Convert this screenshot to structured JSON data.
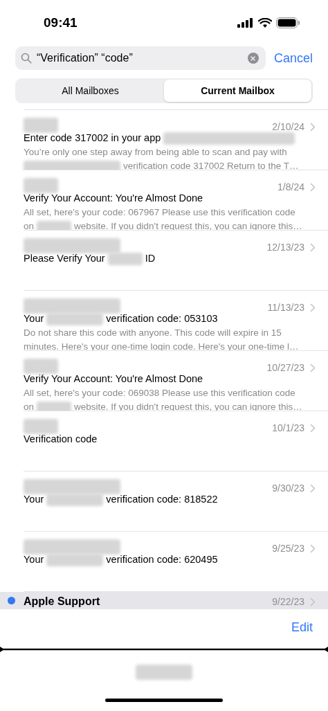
{
  "status_bar": {
    "time": "09:41"
  },
  "search": {
    "value": "“Verification” “code”",
    "cancel": "Cancel"
  },
  "scopes": [
    {
      "label": "All Mailboxes",
      "selected": false
    },
    {
      "label": "Current Mailbox",
      "selected": true
    }
  ],
  "messages": [
    {
      "sender": {
        "kind": "short"
      },
      "date": "2/10/24",
      "unread": false,
      "selected": false,
      "subject": [
        {
          "kind": "text",
          "text": "Enter code 317002 in your app"
        },
        {
          "kind": "wide"
        }
      ],
      "preview": [
        [
          {
            "kind": "text",
            "text": "You’re only one step away from being able to scan and pay with"
          }
        ],
        [
          {
            "kind": "long"
          },
          {
            "kind": "text",
            "text": "verification code 317002 Return to the T…"
          }
        ]
      ]
    },
    {
      "sender": {
        "kind": "short"
      },
      "date": "1/8/24",
      "unread": false,
      "selected": false,
      "subject": [
        {
          "kind": "text",
          "text": "Verify Your Account: You're Almost Done"
        }
      ],
      "preview": [
        [
          {
            "kind": "text",
            "text": "All set, here's your code: 067967 Please use this verification code"
          }
        ],
        [
          {
            "kind": "text",
            "text": "on"
          },
          {
            "kind": "short"
          },
          {
            "kind": "text",
            "text": "website. If you didn't request this, you can ignore this…"
          }
        ]
      ]
    },
    {
      "sender": {
        "kind": "long"
      },
      "date": "12/13/23",
      "unread": false,
      "selected": false,
      "subject": [
        {
          "kind": "text",
          "text": "Please Verify Your"
        },
        {
          "kind": "short"
        },
        {
          "kind": "text",
          "text": "ID"
        }
      ]
    },
    {
      "sender": {
        "kind": "long"
      },
      "date": "11/13/23",
      "unread": false,
      "selected": false,
      "subject": [
        {
          "kind": "text",
          "text": "Your"
        },
        {
          "kind": "medium"
        },
        {
          "kind": "text",
          "text": "verification code: 053103"
        }
      ],
      "preview": [
        [
          {
            "kind": "text",
            "text": "Do not share this code with anyone. This code will expire in 15"
          }
        ],
        [
          {
            "kind": "text",
            "text": "minutes. Here's your one-time login code. Here's your one-time l…"
          }
        ]
      ]
    },
    {
      "sender": {
        "kind": "short"
      },
      "date": "10/27/23",
      "unread": false,
      "selected": false,
      "subject": [
        {
          "kind": "text",
          "text": "Verify Your Account: You're Almost Done"
        }
      ],
      "preview": [
        [
          {
            "kind": "text",
            "text": "All set, here's your code: 069038 Please use this verification code"
          }
        ],
        [
          {
            "kind": "text",
            "text": "on"
          },
          {
            "kind": "short"
          },
          {
            "kind": "text",
            "text": "website. If you didn't request this, you can ignore this…"
          }
        ]
      ]
    },
    {
      "sender": {
        "kind": "short"
      },
      "date": "10/1/23",
      "unread": false,
      "selected": false,
      "subject": [
        {
          "kind": "text",
          "text": "Verification code"
        }
      ]
    },
    {
      "sender": {
        "kind": "long"
      },
      "date": "9/30/23",
      "unread": false,
      "selected": false,
      "subject": [
        {
          "kind": "text",
          "text": "Your"
        },
        {
          "kind": "medium"
        },
        {
          "kind": "text",
          "text": "verification code: 818522"
        }
      ]
    },
    {
      "sender": {
        "kind": "long"
      },
      "date": "9/25/23",
      "unread": false,
      "selected": false,
      "subject": [
        {
          "kind": "text",
          "text": "Your"
        },
        {
          "kind": "medium"
        },
        {
          "kind": "text",
          "text": "verification code: 620495"
        }
      ]
    },
    {
      "sender": {
        "kind": "text",
        "text": "Apple Support"
      },
      "date": "9/22/23",
      "unread": true,
      "selected": true
    }
  ],
  "toolbar": {
    "edit": "Edit"
  },
  "bottom_label": {
    "kind": "medium"
  }
}
